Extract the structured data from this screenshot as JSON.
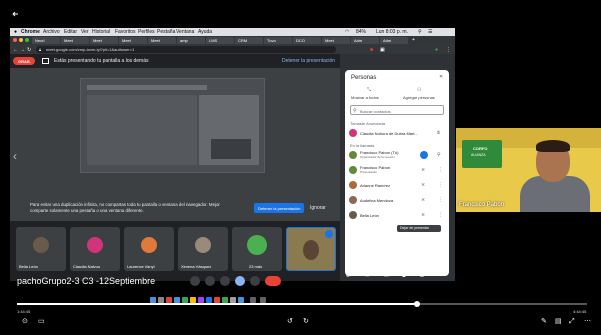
{
  "browser": {
    "menubar": [
      "Chrome",
      "Archivo",
      "Editar",
      "Ver",
      "Historial",
      "Favoritos",
      "Perfiles",
      "Pestaña",
      "Ventana",
      "Ayuda"
    ],
    "clock": "Lun 8:03 p. m.",
    "battery": "84%",
    "tabs": [
      "Neuri",
      "Meet",
      "Meet",
      "Meet",
      "Meet",
      "amp",
      "LMS",
      "CRM",
      "Tuvo",
      "DCO",
      "Meet",
      "Adm",
      "Adm"
    ],
    "url": "meet.google.com/zmp-tovm-tyl?pli=1&authuser=1"
  },
  "meet": {
    "rec_label": "GRAB.",
    "banner_text": "Estás presentando tu pantalla a los demás",
    "stop_presenting": "Detener la presentación",
    "warning_text": "Para evitar una duplicación infinita, no compartas toda tu pantalla o ventana del navegador. Mejor comparte solamente una pestaña o una ventana diferente.",
    "stop_button": "Detener la presentación",
    "ignore_button": "Ignorar",
    "tiles": [
      "Bella León",
      "Claudia Nalvuu",
      "Laurence Vanyl",
      "Ximena Vásquez",
      "23 más",
      ""
    ],
    "meeting_name": "pachoGrupo2-3 C3 -12Septiembre"
  },
  "people": {
    "title": "Personas",
    "show_all": "Mostrar a todos",
    "add_people": "Agregar personas",
    "search_placeholder": "Buscar contactos",
    "host_section": "Tomaste Anunciada",
    "host_name": "Claudia Nohora de Dubra Mart...",
    "in_call_section": "En la llamada",
    "participants": [
      {
        "name": "Francisco Pabon (Tú)",
        "sub": "Organizador de la reunión",
        "color": "#5f8a3b"
      },
      {
        "name": "Francisco Pabon",
        "sub": "Presentando",
        "color": "#5f8a3b"
      },
      {
        "name": "Arianne Ramírez",
        "sub": "",
        "color": "#b06a3a"
      },
      {
        "name": "Audelina Mendoza",
        "sub": "",
        "color": "#8a6a55"
      },
      {
        "name": "Bella León",
        "sub": "",
        "color": "#6a5a4a"
      }
    ],
    "tooltip": "Dejar de presentar"
  },
  "self_view": {
    "name": "Francisco Pabon",
    "sign_line1": "CORFO",
    "sign_line2": "ALIANZA"
  },
  "player": {
    "time_current": "1:44:45",
    "time_total": "4:44:45"
  },
  "colors": {
    "meet_red": "#ea4335",
    "meet_blue": "#1a73e8",
    "wall_yellow": "#e9c94a",
    "sign_green": "#2f8b3a",
    "progress": "#ffffff"
  }
}
